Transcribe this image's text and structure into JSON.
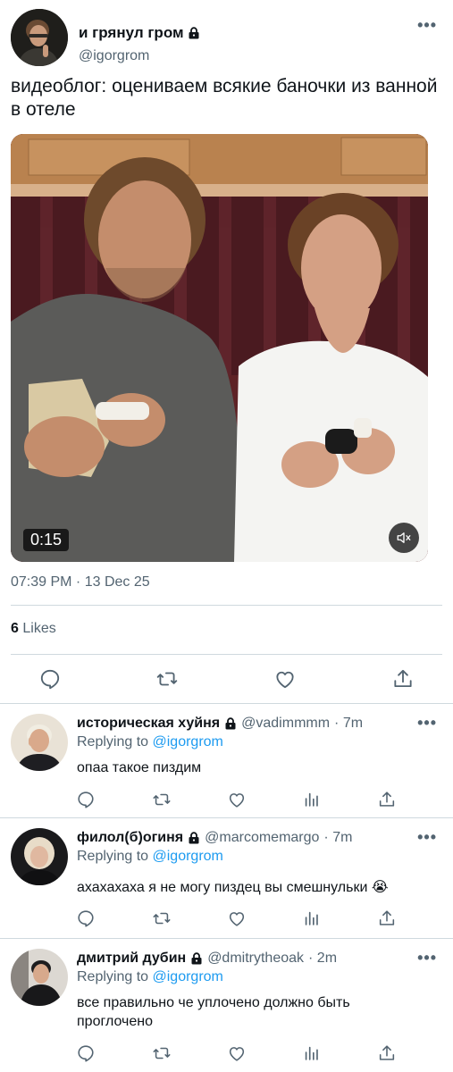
{
  "colors": {
    "link": "#1d9bf0",
    "muted": "#536471",
    "divider": "#cfd9de",
    "text": "#0f1419"
  },
  "main_tweet": {
    "author_name": "и грянул гром",
    "author_handle": "@igorgrom",
    "protected_icon": "lock-icon",
    "more_label": "•••",
    "text": "видеоблог: оцениваем всякие баночки из ванной в отеле",
    "video": {
      "duration": "0:15",
      "mute_icon": "mute-icon"
    },
    "timestamp": "07:39 PM · 13 Dec 25",
    "likes_count": "6",
    "likes_label": "Likes",
    "actions": [
      "reply-icon",
      "retweet-icon",
      "like-icon",
      "share-icon"
    ]
  },
  "replies": [
    {
      "name": "историческая хуйня",
      "handle": "@vadimmmm",
      "time": "· 7m",
      "replying_prefix": "Replying to",
      "replying_to": "@igorgrom",
      "text": "опаа такое пиздим"
    },
    {
      "name": "филол(б)огиня",
      "handle": "@marcomemargo",
      "time": "· 7m",
      "replying_prefix": "Replying to",
      "replying_to": "@igorgrom",
      "text": "ахахахаха я не могу пиздец вы смешнульки 😭"
    },
    {
      "name": "дмитрий дубин",
      "handle": "@dmitrytheoak",
      "time": "· 2m",
      "replying_prefix": "Replying to",
      "replying_to": "@igorgrom",
      "text": "все правильно че уплочено должно быть проглочено"
    }
  ],
  "reply_actions": [
    "reply-icon",
    "retweet-icon",
    "like-icon",
    "analytics-icon",
    "share-icon"
  ]
}
